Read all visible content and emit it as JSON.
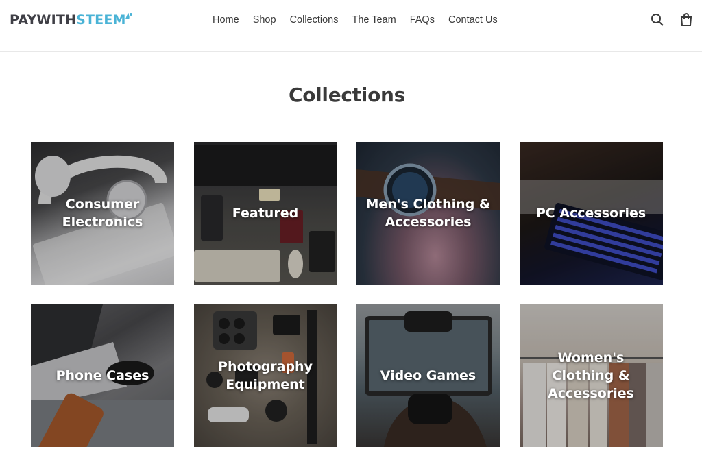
{
  "header": {
    "logo": {
      "part1": "PAYWITH",
      "part2": "STEEM"
    },
    "nav": [
      "Home",
      "Shop",
      "Collections",
      "The Team",
      "FAQs",
      "Contact Us"
    ],
    "icons": [
      "search-icon",
      "cart-icon"
    ]
  },
  "main": {
    "title": "Collections",
    "collections": [
      {
        "label": "Consumer Electronics"
      },
      {
        "label": "Featured"
      },
      {
        "label": "Men's Clothing & Accessories"
      },
      {
        "label": "PC Accessories"
      },
      {
        "label": "Phone Cases"
      },
      {
        "label": "Photography Equipment"
      },
      {
        "label": "Video Games"
      },
      {
        "label": "Women's Clothing & Accessories"
      }
    ]
  },
  "colors": {
    "brand_dark": "#3f3f46",
    "brand_accent": "#4ab3d6",
    "text": "#3a3a3a"
  }
}
